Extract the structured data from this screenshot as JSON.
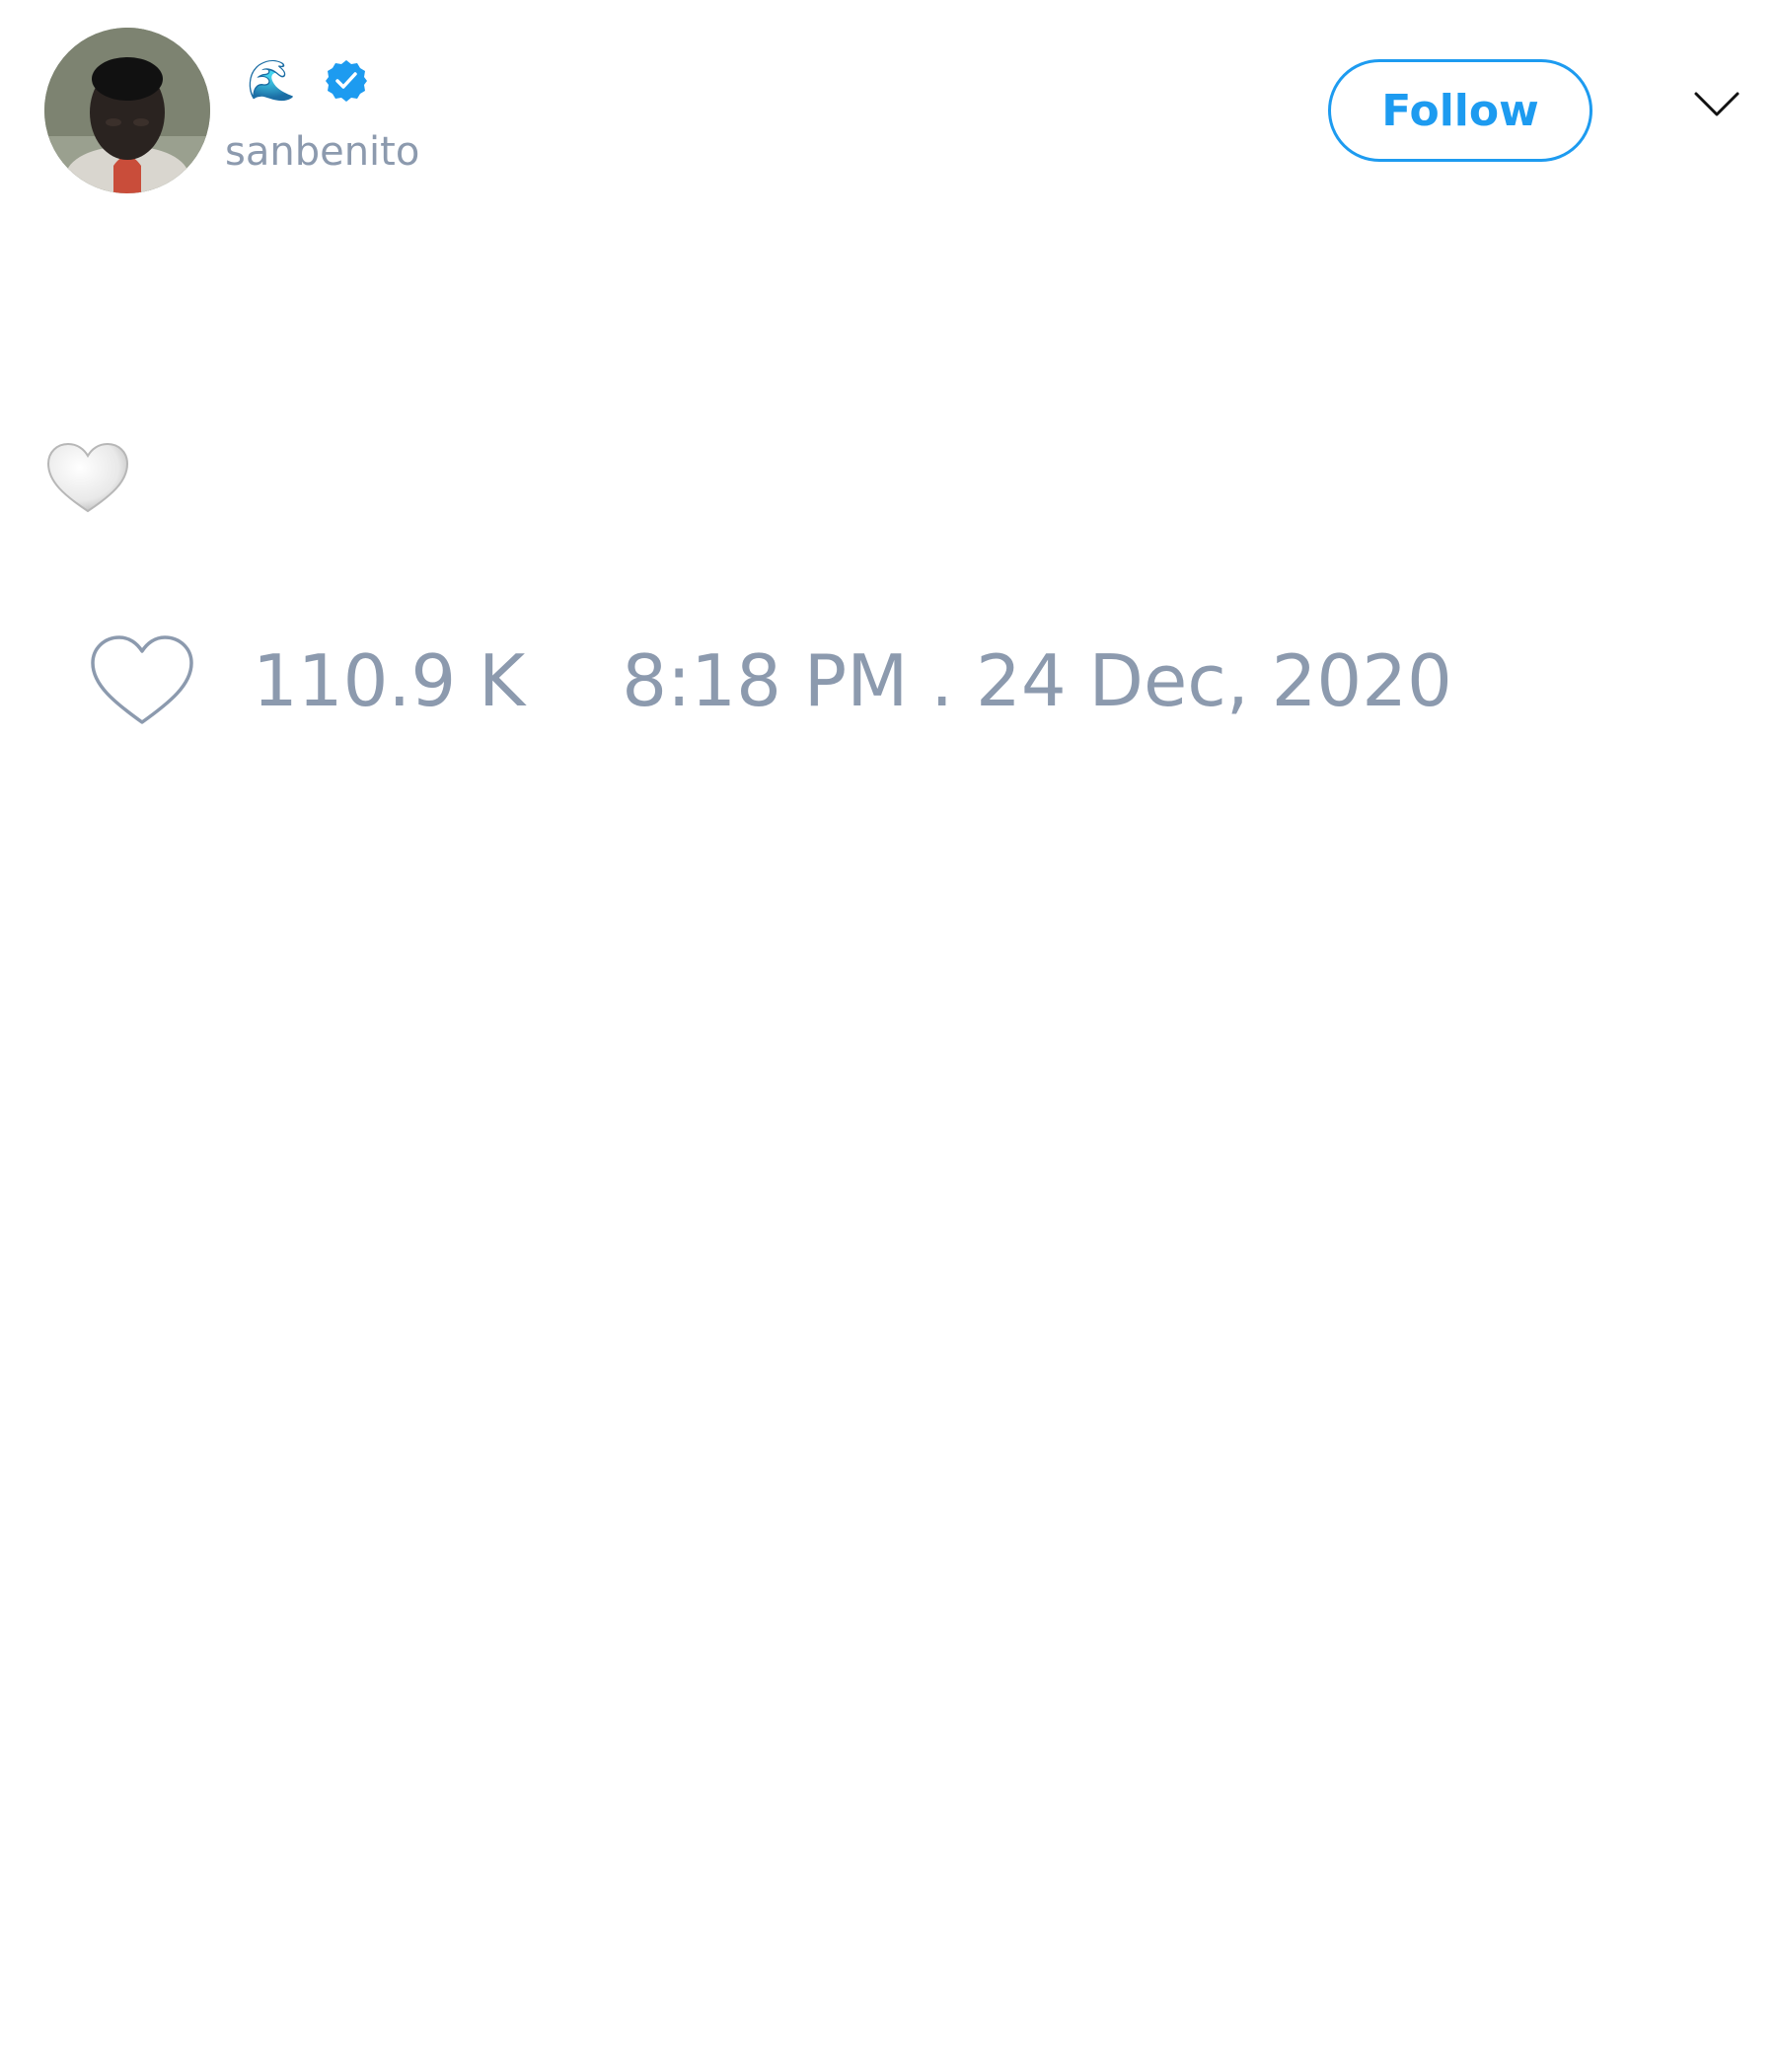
{
  "author": {
    "display_name_emoji": "🌊",
    "handle": "sanbenito",
    "verified": true,
    "avatar_icon": "user-photo"
  },
  "header": {
    "follow_label": "Follow",
    "more_icon": "chevron-down-icon"
  },
  "tweet": {
    "text_emoji": "white-heart-emoji"
  },
  "stats": {
    "like_icon": "heart-outline-icon",
    "like_count": "110.9 K",
    "timestamp": "8:18 PM . 24 Dec, 2020"
  },
  "colors": {
    "accent": "#1d9bf0",
    "muted_text": "#8c9aae",
    "background": "#ffffff"
  }
}
